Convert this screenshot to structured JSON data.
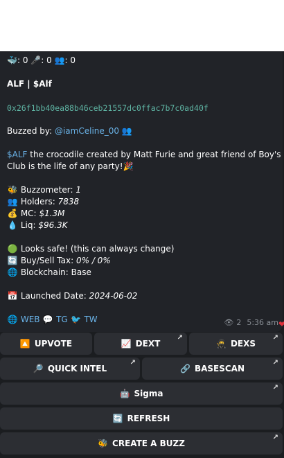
{
  "message": {
    "stats_line": {
      "whales": "0",
      "mic": "0",
      "people": "0"
    },
    "token_name": "ALF | $Alf",
    "contract": "0x26f1bb40ea88b46ceb21557dc0ffac7b7c0ad40f",
    "buzzed_by_label": "Buzzed by:",
    "buzzed_by_user": "@iamCeline_00",
    "desc_cashtag": "$ALF",
    "desc_line1": " the crocodile created by Matt Furie and great friend of Boy's",
    "desc_line2": "Club is the life of any party!",
    "buzzometer_label": "Buzzometer:",
    "buzzometer_value": "1",
    "holders_label": "Holders:",
    "holders_value": "7838",
    "mc_label": "MC:",
    "mc_value": "$1.3M",
    "liq_label": "Liq:",
    "liq_value": "$96.3K",
    "safe_text": "Looks safe! (this can always change)",
    "tax_label": "Buy/Sell Tax:",
    "tax_value": "0% / 0%",
    "chain_label": "Blockchain:",
    "chain_value": "Base",
    "launch_label": "Launched Date:",
    "launch_value": "2024-06-02",
    "links": {
      "web": "WEB",
      "tg": "TG",
      "tw": "TW"
    },
    "views": "2",
    "time": "5:36 am"
  },
  "buttons": {
    "upvote": "UPVOTE",
    "dext": "DEXT",
    "dexs": "DEXS",
    "quick_intel": "QUICK INTEL",
    "basescan": "BASESCAN",
    "sigma": "Sigma",
    "refresh": "REFRESH",
    "create_buzz": "CREATE A BUZZ"
  },
  "icons": {
    "whale": "🐳",
    "mic": "🎤",
    "people": "👥",
    "party": "🎉",
    "bee": "🐝",
    "money": "💰",
    "drop": "💧",
    "green_circle": "🟢",
    "cycle": "🔄",
    "globe": "🌐",
    "calendar": "📅",
    "speech": "💬",
    "bird": "🐦",
    "eye": "👁",
    "heart": "❤",
    "up_box": "🔼",
    "chart": "📈",
    "ninja": "🥷",
    "magnifier": "🔎",
    "link": "🔗",
    "robot": "🤖",
    "arrow": "↗"
  }
}
